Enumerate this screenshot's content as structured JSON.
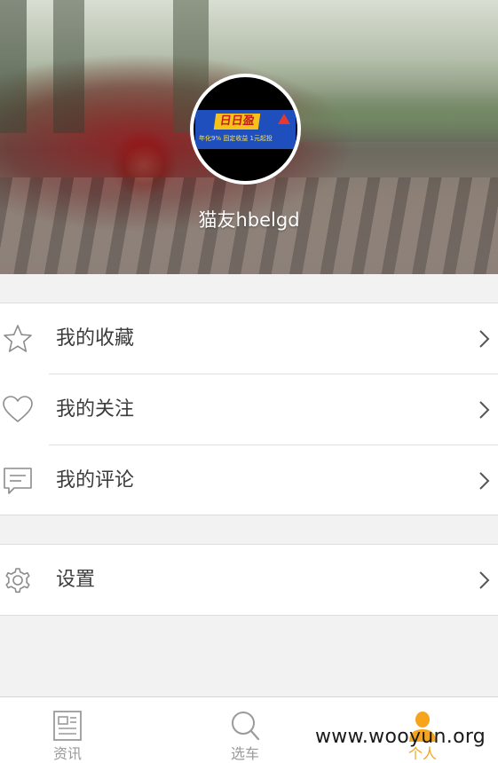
{
  "profile": {
    "username": "猫友hbelgd",
    "avatar_banner_title": "日日盈",
    "avatar_banner_tagline": "年化9%  固定收益  1元起投"
  },
  "menu": {
    "group1": [
      {
        "label": "我的收藏",
        "icon": "star-icon"
      },
      {
        "label": "我的关注",
        "icon": "heart-icon"
      },
      {
        "label": "我的评论",
        "icon": "comment-icon"
      }
    ],
    "group2": [
      {
        "label": "设置",
        "icon": "gear-icon"
      }
    ]
  },
  "tabbar": {
    "tabs": [
      {
        "label": "资讯",
        "icon": "news-icon",
        "active": false
      },
      {
        "label": "选车",
        "icon": "search-icon",
        "active": false
      },
      {
        "label": "个人",
        "icon": "person-icon",
        "active": true
      }
    ]
  },
  "watermark": "www.wooyun.org",
  "colors": {
    "accent": "#f7a41d",
    "text": "#3c3c3c",
    "inactive": "#9a9a9a",
    "background": "#f2f2f2"
  }
}
